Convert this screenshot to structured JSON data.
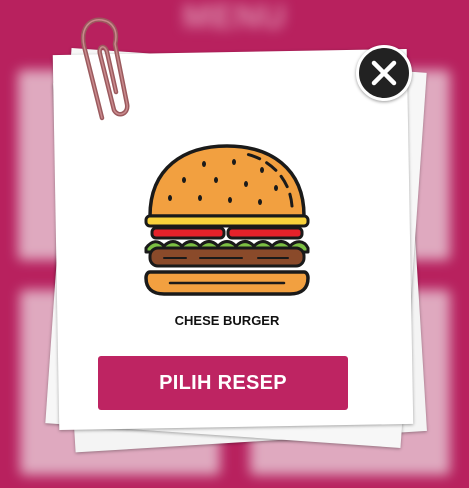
{
  "background": {
    "title": "MENU"
  },
  "popup": {
    "item_name": "CHESE BURGER",
    "select_label": "PILIH RESEP",
    "close_icon": "close-icon",
    "item_icon": "burger-icon"
  },
  "colors": {
    "background": "#b8215f",
    "button": "#be2462",
    "close_button": "#222222"
  }
}
